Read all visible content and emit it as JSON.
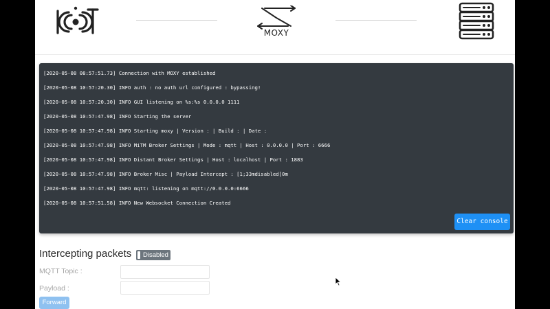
{
  "header": {
    "logo_left_icon": "iot-logo",
    "logo_center_icon": "moxy-proxy-arrows-icon",
    "logo_center_label": "MOXY",
    "logo_right_icon": "server-icon"
  },
  "console": {
    "lines": [
      "[2020-05-08 08:57:51.73] Connection with MOXY established",
      "[2020-05-08 10:57:20.30] INFO auth : no auth url configured : bypassing!",
      "[2020-05-08 10:57:20.30] INFO GUI listening on %s:%s 0.0.0.0 1111",
      "[2020-05-08 10:57:47.98] INFO Starting the server",
      "[2020-05-08 10:57:47.98] INFO Starting moxy | Version : | Build : | Date :",
      "[2020-05-08 10:57:47.98] INFO MiTM Broker Settings | Mode : mqtt | Host : 0.0.0.0 | Port : 6666",
      "[2020-05-08 10:57:47.98] INFO Distant Broker Settings | Host : localhost | Port : 1883",
      "[2020-05-08 10:57:47.98] INFO Broker Misc | Payload Intercept : [1;33mdisabled[0m",
      "[2020-05-08 10:57:47.98] INFO mqtt: listening on mqtt://0.0.0.0:6666",
      "[2020-05-08 10:57:51.58] INFO New Websocket Connection Created"
    ],
    "clear_label": "Clear console"
  },
  "intercept": {
    "title": "Intercepting packets",
    "toggle_label": "Disabled",
    "topic_label": "MQTT Topic :",
    "topic_value": "",
    "payload_label": "Payload :",
    "payload_value": "",
    "forward_label": "Forward"
  },
  "colors": {
    "console_bg": "#343a40",
    "accent": "#1e90f5",
    "toggle_bg": "#6c757d",
    "forward_disabled": "#8fc1f0"
  }
}
